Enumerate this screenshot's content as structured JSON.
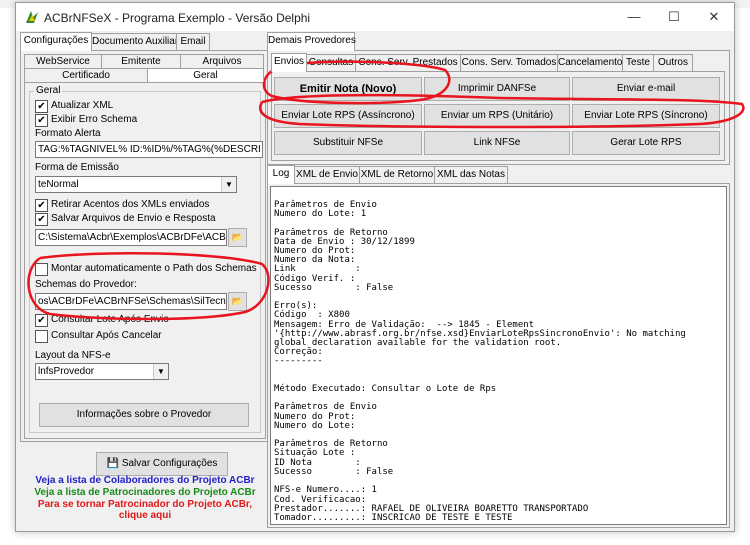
{
  "window": {
    "title": "ACBrNFSeX - Programa Exemplo - Versão Delphi",
    "minimize": "—",
    "maximize": "☐",
    "close": "✕"
  },
  "left_tabs": [
    "Configurações",
    "Documento Auxiliar",
    "Email"
  ],
  "left_subtabs_row1": [
    "WebService",
    "Emitente",
    "Arquivos"
  ],
  "left_subtabs_row2": [
    "Certificado",
    "Geral"
  ],
  "geral": {
    "group_label": "Geral",
    "atualizar_xml": "Atualizar XML",
    "exibir_erro": "Exibir Erro Schema",
    "formato_alerta_label": "Formato Alerta",
    "formato_alerta_value": "TAG:%TAGNIVEL% ID:%ID%/%TAG%(%DESCRI",
    "forma_emissao_label": "Forma de Emissão",
    "forma_emissao_value": "teNormal",
    "retirar_acentos": "Retirar Acentos dos XMLs enviados",
    "salvar_arquivos": "Salvar Arquivos de Envio e Resposta",
    "path_salvar": "C:\\Sistema\\Acbr\\Exemplos\\ACBrDFe\\ACBrNFS",
    "montar_path": "Montar automaticamente o Path dos Schemas",
    "schemas_label": "Schemas do Provedor:",
    "schemas_value": "os\\ACBrDFe\\ACBrNFSe\\Schemas\\SilTecnologia",
    "consultar_apos_envio": "Consultar Lote Após Envio",
    "consultar_apos_cancelar": "Consultar Após Cancelar",
    "layout_label": "Layout da NFS-e",
    "layout_value": "lnfsProvedor",
    "info_provedor": "Informações sobre o Provedor"
  },
  "bottom": {
    "salvar": "Salvar Configurações",
    "colab": "Veja a lista de Colaboradores do Projeto ACBr",
    "patroc": "Veja a lista de Patrocinadores do Projeto ACBr",
    "tornar_1": "Para se tornar Patrocinador do Projeto ACBr,",
    "tornar_2": "clique aqui",
    "color_blue": "#1f1fc8",
    "color_green": "#1a8a1a",
    "color_red": "#e01818"
  },
  "right_top_tab": "Demais Provedores",
  "right_tabs": [
    "Envios",
    "Consultas",
    "Cons. Serv. Prestados",
    "Cons. Serv. Tomados",
    "Cancelamento",
    "Teste",
    "Outros"
  ],
  "buttons": {
    "emitir": "Emitir Nota (Novo)",
    "imprimir": "Imprimir DANFSe",
    "enviar_email": "Enviar e-mail",
    "lote_assinc": "Enviar Lote RPS (Assíncrono)",
    "um_rps": "Enviar um RPS (Unitário)",
    "lote_sinc": "Enviar Lote RPS (Síncrono)",
    "substituir": "Substituir NFSe",
    "link": "Link NFSe",
    "gerar_lote": "Gerar Lote RPS"
  },
  "log_tabs": [
    "Log",
    "XML de Envio",
    "XML de Retorno",
    "XML das Notas"
  ],
  "log_lines": [
    "Parâmetros de Envio",
    "Numero do Lote: 1",
    "",
    "Parâmetros de Retorno",
    "Data de Envio : 30/12/1899",
    "Numero do Prot:",
    "Numero da Nota:",
    "Link           :",
    "Código Verif. :",
    "Sucesso        : False",
    "",
    "Erro(s):",
    "Código  : X800",
    "Mensagem: Erro de Validação:  --> 1845 - Element",
    "'{http://www.abrasf.org.br/nfse.xsd}EnviarLoteRpsSincronoEnvio': No matching",
    "global declaration available for the validation root.",
    "Correção:",
    "---------",
    "",
    "",
    "Método Executado: Consultar o Lote de Rps",
    "",
    "Parâmetros de Envio",
    "Numero do Prot:",
    "Numero do Lote:",
    "",
    "Parâmetros de Retorno",
    "Situação Lote :",
    "ID Nota        :",
    "Sucesso        : False",
    "",
    "NFS-e Numero....: 1",
    "Cod. Verificacao:",
    "Prestador.......: RAFAEL DE OLIVEIRA BOARETTO TRANSPORTADO",
    "Tomador.........: INSCRICAO DE TESTE E TESTE"
  ]
}
